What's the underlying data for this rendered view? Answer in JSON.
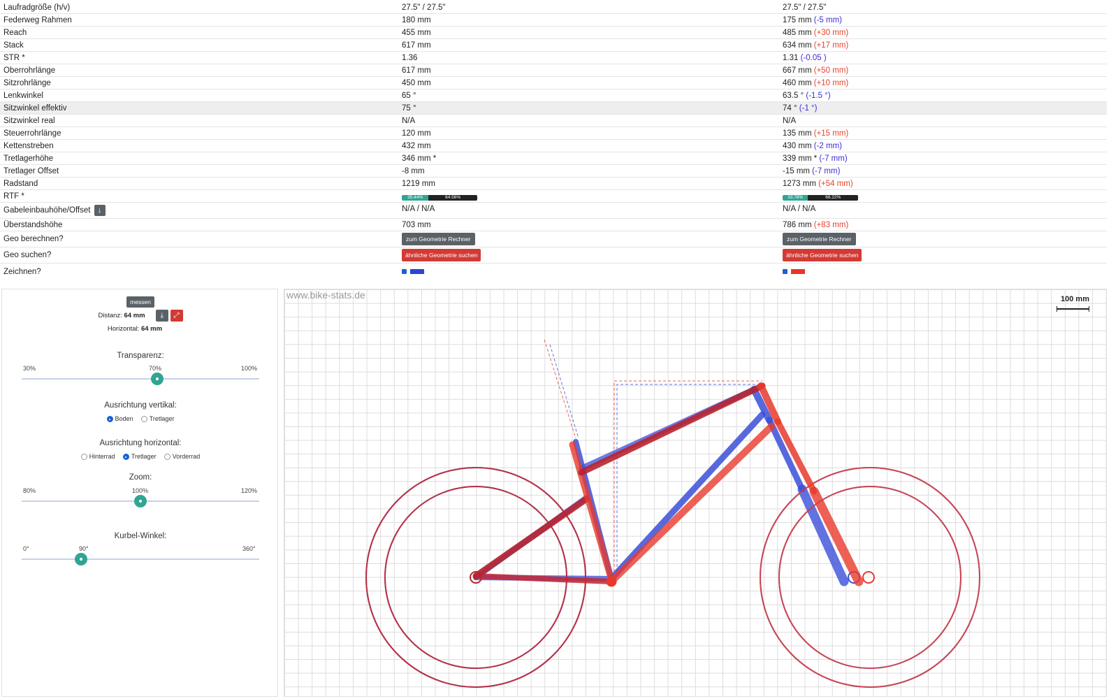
{
  "geometry_rows": [
    {
      "label": "Laufradgröße (h/v)",
      "a": "27.5\" / 27.5\"",
      "b": "27.5\" / 27.5\"",
      "diff": "",
      "diff_dir": ""
    },
    {
      "label": "Federweg Rahmen",
      "a": "180 mm",
      "b": "175 mm",
      "diff": "(-5 mm)",
      "diff_dir": "neg"
    },
    {
      "label": "Reach",
      "a": "455 mm",
      "b": "485 mm",
      "diff": "(+30 mm)",
      "diff_dir": "pos"
    },
    {
      "label": "Stack",
      "a": "617 mm",
      "b": "634 mm",
      "diff": "(+17 mm)",
      "diff_dir": "pos"
    },
    {
      "label": "STR *",
      "a": "1.36",
      "b": "1.31",
      "diff": "(-0.05 )",
      "diff_dir": "neg"
    },
    {
      "label": "Oberrohrlänge",
      "a": "617 mm",
      "b": "667 mm",
      "diff": "(+50 mm)",
      "diff_dir": "pos"
    },
    {
      "label": "Sitzrohrlänge",
      "a": "450 mm",
      "b": "460 mm",
      "diff": "(+10 mm)",
      "diff_dir": "pos"
    },
    {
      "label": "Lenkwinkel",
      "a": "65 °",
      "b": "63.5 °",
      "diff": "(-1.5 °)",
      "diff_dir": "neg"
    },
    {
      "label": "Sitzwinkel effektiv",
      "a": "75 °",
      "b": "74 °",
      "diff": "(-1 °)",
      "diff_dir": "neg",
      "highlight": true
    },
    {
      "label": "Sitzwinkel real",
      "a": "N/A",
      "b": "N/A",
      "diff": "",
      "diff_dir": ""
    },
    {
      "label": "Steuerrohrlänge",
      "a": "120 mm",
      "b": "135 mm",
      "diff": "(+15 mm)",
      "diff_dir": "pos"
    },
    {
      "label": "Kettenstreben",
      "a": "432 mm",
      "b": "430 mm",
      "diff": "(-2 mm)",
      "diff_dir": "neg"
    },
    {
      "label": "Tretlagerhöhe",
      "a": "346 mm *",
      "b": "339 mm *",
      "diff": "(-7 mm)",
      "diff_dir": "neg"
    },
    {
      "label": "Tretlager Offset",
      "a": "-8 mm",
      "b": "-15 mm",
      "diff": "(-7 mm)",
      "diff_dir": "neg"
    },
    {
      "label": "Radstand",
      "a": "1219 mm",
      "b": "1273 mm",
      "diff": "(+54 mm)",
      "diff_dir": "pos"
    }
  ],
  "rtf": {
    "label": "RTF *",
    "a": {
      "left_label": "35.44%",
      "right_label": "64.56%",
      "fraction": 0.3544
    },
    "b": {
      "left_label": "33.78%",
      "right_label": "66.22%",
      "fraction": 0.3378
    }
  },
  "fork_row": {
    "label": "Gabeleinbauhöhe/Offset",
    "icon": "arrow-down-icon",
    "a": "N/A / N/A",
    "b": "N/A / N/A"
  },
  "standover_row": {
    "label": "Überstandshöhe",
    "a": "703 mm",
    "b": "786 mm",
    "diff": "(+83 mm)"
  },
  "calc_row": {
    "label": "Geo berechnen?",
    "button": "zum Geometrie Rechner"
  },
  "search_row": {
    "label": "Geo suchen?",
    "button": "ähnliche Geometrie suchen"
  },
  "draw_row": {
    "label": "Zeichnen?",
    "color_a": "#2b45d6",
    "color_b": "#e8352b"
  },
  "controls": {
    "measure_button": "messen",
    "distance_label": "Distanz:",
    "distance_value": "64 mm",
    "horizontal_label": "Horizontal:",
    "horizontal_value": "64 mm",
    "download_icon": "download-icon",
    "expand_icon": "expand-icon",
    "transparency": {
      "label": "Transparenz:",
      "min": "30%",
      "current": "70%",
      "max": "100%",
      "fraction": 0.571
    },
    "align_vertical": {
      "label": "Ausrichtung vertikal:",
      "options": [
        "Boden",
        "Tretlager"
      ],
      "selected": "Boden"
    },
    "align_horizontal": {
      "label": "Ausrichtung horizontal:",
      "options": [
        "Hinterrad",
        "Tretlager",
        "Vorderrad"
      ],
      "selected": "Tretlager"
    },
    "zoom": {
      "label": "Zoom:",
      "min": "80%",
      "current": "100%",
      "max": "120%",
      "fraction": 0.5
    },
    "crank": {
      "label": "Kurbel-Winkel:",
      "min": "0°",
      "current": "90°",
      "max": "360°",
      "fraction": 0.25
    }
  },
  "canvas": {
    "watermark": "www.bike-stats.de",
    "scale_label": "100 mm",
    "bike_a_color": "#3b4fd8",
    "bike_b_color": "#e8392c",
    "bike_overlap_color": "#b8242f"
  }
}
